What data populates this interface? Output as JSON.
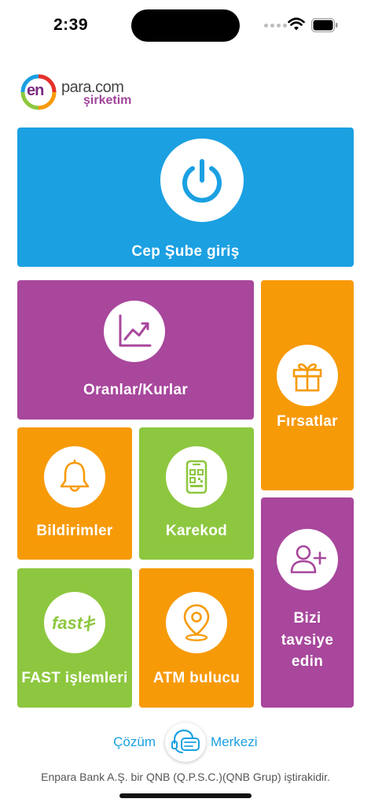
{
  "status_bar": {
    "time": "2:39"
  },
  "logo": {
    "en": "en",
    "para": "para.com",
    "sirketim": "şirketim"
  },
  "tiles": {
    "cep_sube": "Cep Şube giriş",
    "oranlar": "Oranlar/Kurlar",
    "firsatlar": "Fırsatlar",
    "bildirimler": "Bildirimler",
    "karekod": "Karekod",
    "davet": {
      "line1": "Bizi",
      "line2": "tavsiye",
      "line3": "edin"
    },
    "fast": "FAST işlemleri",
    "fast_logo": "fast",
    "atm": "ATM bulucu"
  },
  "footer": {
    "help_left": "Çözüm",
    "help_right": "Merkezi",
    "legal": "Enpara Bank A.Ş. bir QNB (Q.P.S.C.)(QNB Grup) iştirakidir."
  },
  "colors": {
    "blue": "#1ba0e2",
    "purple": "#a8479c",
    "orange": "#f79a08",
    "green": "#8dc73f"
  },
  "icons": [
    "power-icon",
    "chart-icon",
    "gift-icon",
    "bell-icon",
    "qr-phone-icon",
    "add-user-icon",
    "fast-logo-icon",
    "location-pin-icon",
    "support-headset-icon"
  ]
}
